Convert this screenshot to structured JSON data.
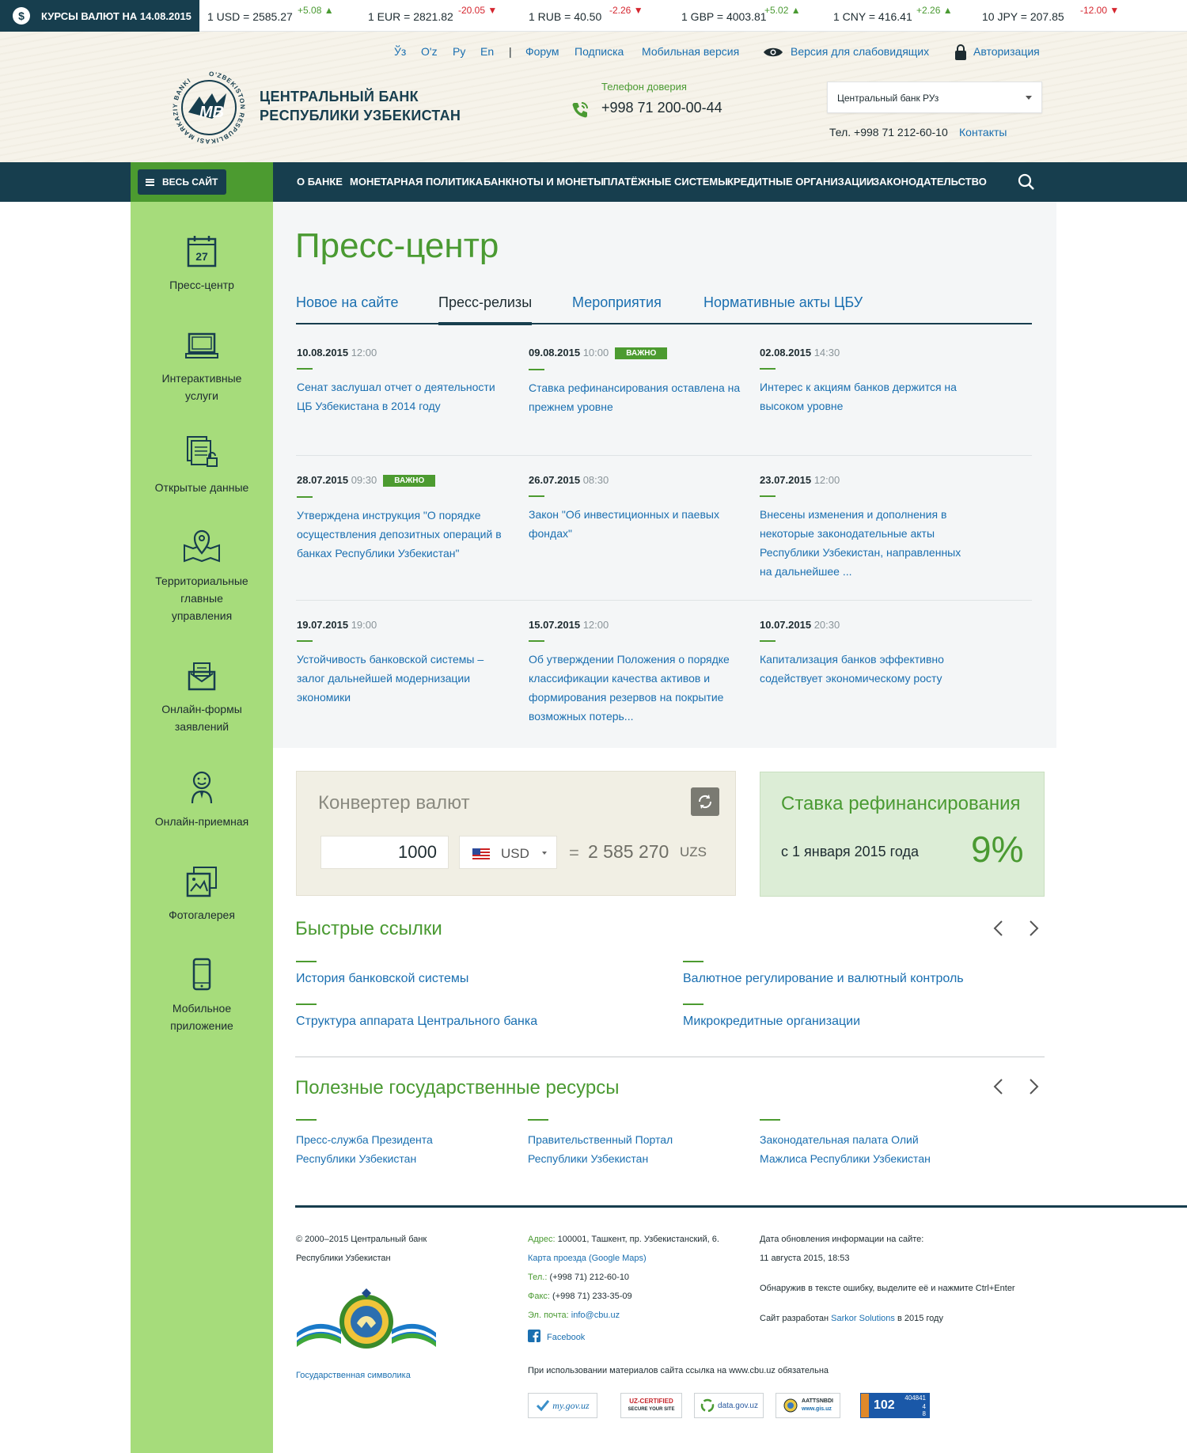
{
  "ticker": {
    "label": "КУРСЫ ВАЛЮТ НА 14.08.2015",
    "rates": [
      {
        "text": "1 USD = 2585.27",
        "delta": "+5.08",
        "dir": "up"
      },
      {
        "text": "1 EUR = 2821.82",
        "delta": "-20.05",
        "dir": "down"
      },
      {
        "text": "1 RUB = 40.50",
        "delta": "-2.26",
        "dir": "down"
      },
      {
        "text": "1 GBP = 4003.81",
        "delta": "+5.02",
        "dir": "up"
      },
      {
        "text": "1 CNY = 416.41",
        "delta": "+2.26",
        "dir": "up"
      },
      {
        "text": "10 JPY = 207.85",
        "delta": "-12.00",
        "dir": "down"
      }
    ]
  },
  "toplinks": {
    "lang_uz_cyr": "Ўз",
    "lang_uz_lat": "O'z",
    "lang_ru": "Ру",
    "lang_en": "En",
    "separator": "|",
    "forum": "Форум",
    "subscribe": "Подписка",
    "mobile": "Мобильная версия",
    "impaired": "Версия для слабовидящих",
    "auth": "Авторизация"
  },
  "brand": {
    "line1": "ЦЕНТРАЛЬНЫЙ БАНК",
    "line2": "РЕСПУБЛИКИ УЗБЕКИСТАН",
    "logo_ring_text": "O'ZBEKISTON RESPUBLIKASI MARKAZIY BANKI",
    "logo_mark": "MB"
  },
  "hotline": {
    "label": "Телефон доверия",
    "phone": "+998 71 200-00-44"
  },
  "header_right": {
    "select_value": "Центральный банк РУз",
    "tel": "Тел. +998 71 212-60-10",
    "contacts": "Контакты"
  },
  "nav": {
    "all_site": "ВЕСЬ САЙТ",
    "items": [
      "О БАНКЕ",
      "МОНЕТАРНАЯ ПОЛИТИКА",
      "БАНКНОТЫ И МОНЕТЫ",
      "ПЛАТЁЖНЫЕ СИСТЕМЫ",
      "КРЕДИТНЫЕ ОРГАНИЗАЦИИ",
      "ЗАКОНОДАТЕЛЬСТВО"
    ]
  },
  "sidebar": {
    "calendar_day": "27",
    "items": [
      {
        "label": "Пресс-центр",
        "icon": "calendar-icon"
      },
      {
        "label": "Интерактивные услуги",
        "icon": "laptop-icon"
      },
      {
        "label": "Открытые данные",
        "icon": "documents-icon"
      },
      {
        "label": "Территориальные главные управления",
        "icon": "map-pin-icon"
      },
      {
        "label": "Онлайн-формы заявлений",
        "icon": "envelope-icon"
      },
      {
        "label": "Онлайн-приемная",
        "icon": "person-icon"
      },
      {
        "label": "Фотогалерея",
        "icon": "photo-icon"
      },
      {
        "label": "Мобильное приложение",
        "icon": "phone-icon"
      }
    ]
  },
  "press": {
    "title": "Пресс-центр",
    "tabs": [
      "Новое на сайте",
      "Пресс-релизы",
      "Мероприятия",
      "Нормативные акты ЦБУ"
    ],
    "active_tab": "Пресс-релизы",
    "important_label": "ВАЖНО",
    "news": [
      {
        "date": "10.08.2015",
        "time": "12:00",
        "important": false,
        "title": "Сенат заслушал отчет о деятельности ЦБ Узбекистана в 2014 году"
      },
      {
        "date": "09.08.2015",
        "time": "10:00",
        "important": true,
        "title": "Ставка рефинансирования оставлена на прежнем уровне"
      },
      {
        "date": "02.08.2015",
        "time": "14:30",
        "important": false,
        "title": "Интерес к акциям банков держится на высоком уровне"
      },
      {
        "date": "28.07.2015",
        "time": "09:30",
        "important": true,
        "title": "Утверждена инструкция \"О порядке осуществления депозитных операций в банках Республики Узбекистан\""
      },
      {
        "date": "26.07.2015",
        "time": "08:30",
        "important": false,
        "title": "Закон \"Об инвестиционных и паевых фондах\""
      },
      {
        "date": "23.07.2015",
        "time": "12:00",
        "important": false,
        "title": "Внесены изменения и дополнения в некоторые законодательные акты Республики Узбекистан, направленных на дальнейшее ..."
      },
      {
        "date": "19.07.2015",
        "time": "19:00",
        "important": false,
        "title": "Устойчивость банковской системы – залог дальнейшей модернизации экономики"
      },
      {
        "date": "15.07.2015",
        "time": "12:00",
        "important": false,
        "title": "Об утверждении Положения о порядке классификации качества активов и формирования резервов на покрытие возможных потерь..."
      },
      {
        "date": "10.07.2015",
        "time": "20:30",
        "important": false,
        "title": "Капитализация банков эффективно содействует экономическому росту"
      }
    ]
  },
  "converter": {
    "title": "Конвертер валют",
    "amount": "1000",
    "currency": "USD",
    "equals": "=",
    "result": "2 585 270",
    "result_currency": "UZS"
  },
  "refi": {
    "title": "Ставка рефинансирования",
    "from": "с 1 января 2015 года",
    "value": "9%"
  },
  "quick_links": {
    "title": "Быстрые ссылки",
    "items": [
      "История банковской системы",
      "Валютное регулирование и валютный контроль",
      "Структура аппарата Центрального банка",
      "Микрокредитные организации"
    ]
  },
  "gov_resources": {
    "title": "Полезные государственные ресурсы",
    "items": [
      {
        "line1": "Пресс-служба Президента",
        "line2": "Республики Узбекистан"
      },
      {
        "line1": "Правительственный Портал",
        "line2": "Республики Узбекистан"
      },
      {
        "line1": "Законодательная палата Олий",
        "line2": "Мажлиса Республики Узбекистан"
      }
    ]
  },
  "footer": {
    "copyright1": "© 2000–2015 Центральный банк",
    "copyright2": "Республики Узбекистан",
    "symbols": "Государственная символика",
    "addr_label": "Адрес:",
    "addr": "100001, Ташкент, пр. Узбекистанский, 6.",
    "map": "Карта проезда (Google Maps)",
    "tel_label": "Тел.:",
    "tel": "(+998 71) 212-60-10",
    "fax_label": "Факс:",
    "fax": "(+998 71) 233-35-09",
    "email_label": "Эл. почта:",
    "email": "info@cbu.uz",
    "facebook": "Facebook",
    "update_label": "Дата обновления информации на сайте:",
    "update": "11 августа 2015, 18:53",
    "error_note": "Обнаружив в тексте ошибку, выделите её и нажмите Ctrl+Enter",
    "dev_prefix": "Сайт разработан",
    "dev_name": "Sarkor Solutions",
    "dev_suffix": "в 2015 году",
    "copy_note": "При использовании материалов сайта ссылка на www.cbu.uz обязательна",
    "badges": [
      "my.gov.uz",
      "UZ-CERTIFIED",
      "SECURE YOUR SITE",
      "data.gov.uz",
      "AATTSNBDI",
      "www.gis.uz",
      "404841",
      "102",
      "4",
      "8"
    ]
  },
  "colors": {
    "green": "#4a9a32",
    "navy": "#173e4e",
    "link": "#1a6fb0",
    "sidebar": "#a6dc7b"
  }
}
